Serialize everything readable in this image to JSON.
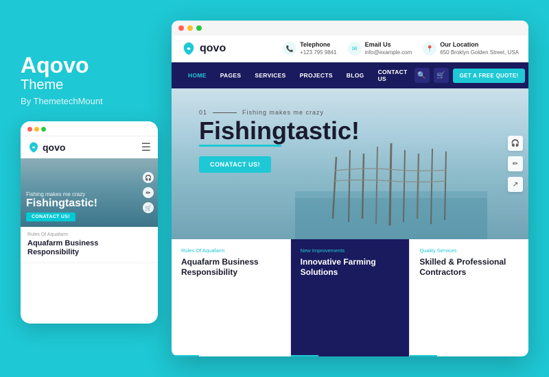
{
  "left": {
    "brand": "Aqovo",
    "theme_label": "Theme",
    "by": "By ThemetechMount"
  },
  "mobile": {
    "logo_text": "qovo",
    "tagline": "Fishing makes me crazy",
    "hero_title": "Fishingtastic!",
    "cta_btn": "CONATACT US!",
    "card_label": "Rules Of Aquafarm",
    "card_title": "Aquafarm Business Responsibility"
  },
  "desktop": {
    "logo_text": "qovo",
    "header": {
      "phone_label": "Telephone",
      "phone_value": "+123 795 9841",
      "email_label": "Email Us",
      "email_value": "info@example.com",
      "location_label": "Our Location",
      "location_value": "650 Broklyn Golden Street, USA"
    },
    "nav": {
      "items": [
        "HOME",
        "PAGES",
        "SERVICES",
        "PROJECTS",
        "BLOG",
        "CONTACT US"
      ],
      "cta": "GET A FREE QUOTE!"
    },
    "hero": {
      "number": "01",
      "tagline": "Fishing makes me crazy",
      "title": "Fishingtastic!",
      "cta": "CONATACT US!"
    },
    "cards": [
      {
        "label": "Rules Of Aquafarm",
        "title": "Aquafarm Business Responsibility",
        "highlight": false
      },
      {
        "label": "New Improvements",
        "title": "Innovative Farming Solutions",
        "highlight": true
      },
      {
        "label": "Quality Services",
        "title": "Skilled & Professional Contractors",
        "highlight": false
      }
    ]
  },
  "colors": {
    "cyan": "#1ec8d4",
    "dark_navy": "#1a1a5e",
    "white": "#ffffff"
  },
  "icons": {
    "phone": "📞",
    "email": "✉",
    "location": "📍",
    "search": "🔍",
    "cart": "🛒",
    "headphone": "🎧",
    "edit": "✏",
    "share": "↗"
  }
}
